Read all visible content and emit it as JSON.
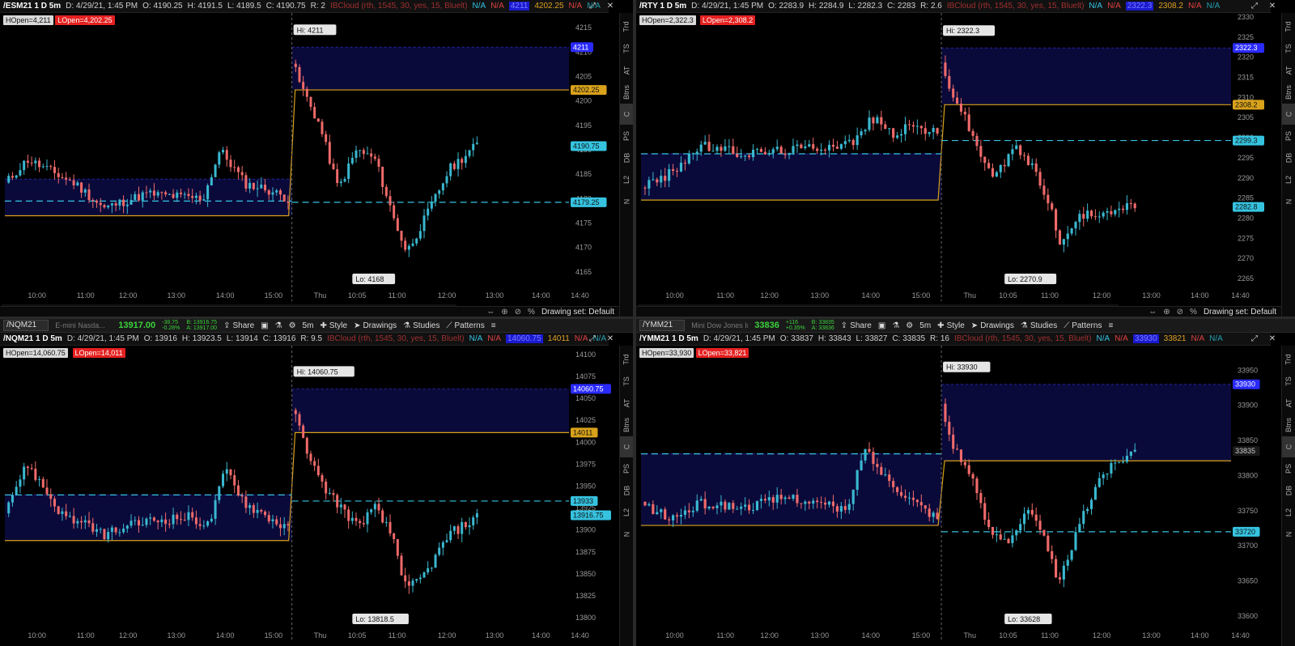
{
  "panes": [
    {
      "id": "esm",
      "toolbar": null,
      "info": {
        "symbol": "/ESM21 1 D 5m",
        "date": "D: 4/29/21, 1:45 PM",
        "open": "O: 4190.25",
        "high": "H: 4191.5",
        "low": "L: 4189.5",
        "close": "C: 4190.75",
        "range": "R: 2",
        "cloud": "IBCloud (rth, 1545, 30, yes, 15, Bluelt)",
        "na1": "N/A",
        "na2": "N/A",
        "val_blue": "4211",
        "val_orange": "4202.25",
        "na3": "N/A",
        "na4": "N/A"
      },
      "hopen": "HOpen=4,211",
      "lopen": "LOpen=4,202.25",
      "hi_label": "Hi: 4211",
      "lo_label": "Lo: 4168",
      "ymin": 4162,
      "ymax": 4218,
      "yticks": [
        "4215",
        "4210",
        "4205",
        "4200",
        "4195",
        "4190",
        "4185",
        "4180",
        "4175",
        "4170",
        "4165"
      ],
      "ytick_vals": [
        4215,
        4210,
        4205,
        4200,
        4195,
        4190,
        4185,
        4180,
        4175,
        4170,
        4165
      ],
      "xticks": [
        "10:00",
        "11:00",
        "12:00",
        "13:00",
        "14:00",
        "15:00",
        "Thu",
        "10:05",
        "11:00",
        "12:00",
        "13:00",
        "14:00",
        "14:40"
      ],
      "tags": [
        {
          "label": "4211",
          "value": 4211,
          "color": "#2a2aff",
          "text": "#fff"
        },
        {
          "label": "4202.25",
          "value": 4202.25,
          "color": "#d9a21b",
          "text": "#111"
        },
        {
          "label": "4190.75",
          "value": 4190.75,
          "color": "#35c3e0",
          "text": "#111"
        },
        {
          "label": "4179.25",
          "value": 4179.25,
          "color": "#35c3e0",
          "text": "#111"
        }
      ],
      "day1": {
        "start": 4183,
        "hi": 4184,
        "lo": 4177,
        "ibhi": 4184,
        "iblo": 4176.5,
        "mid": 4179.25,
        "end": 4178
      },
      "day2": {
        "open": 4206,
        "hi": 4211,
        "lo": 4168,
        "last": 4190.75,
        "ibmid": 4202.25,
        "pivot": 4179.25,
        "gap_top": 4211
      },
      "botbar": {
        "text": "Drawing set: Default"
      }
    },
    {
      "id": "rty",
      "toolbar": null,
      "info": {
        "symbol": "/RTY 1 D 5m",
        "date": "D: 4/29/21, 1:45 PM",
        "open": "O: 2283.9",
        "high": "H: 2284.9",
        "low": "L: 2282.3",
        "close": "C: 2283",
        "range": "R: 2.6",
        "cloud": "IBCloud (rth, 1545, 30, yes, 15, Bluelt)",
        "na1": "N/A",
        "na2": "N/A",
        "val_blue": "2322.3",
        "val_orange": "2308.2",
        "na3": "N/A",
        "na4": "N/A"
      },
      "hopen": "HOpen=2,322.3",
      "lopen": "LOpen=2,308.2",
      "hi_label": "Hi: 2322.3",
      "lo_label": "Lo: 2270.9",
      "ymin": 2263,
      "ymax": 2331,
      "yticks": [
        "2330",
        "2325",
        "2320",
        "2315",
        "2310",
        "2305",
        "2300",
        "2295",
        "2290",
        "2285",
        "2280",
        "2275",
        "2270",
        "2265"
      ],
      "ytick_vals": [
        2330,
        2325,
        2320,
        2315,
        2310,
        2305,
        2300,
        2295,
        2290,
        2285,
        2280,
        2275,
        2270,
        2265
      ],
      "xticks": [
        "10:00",
        "11:00",
        "12:00",
        "13:00",
        "14:00",
        "15:00",
        "Thu",
        "10:05",
        "11:00",
        "12:00",
        "13:00",
        "14:00",
        "14:40"
      ],
      "tags": [
        {
          "label": "2322.3",
          "value": 2322.3,
          "color": "#2a2aff",
          "text": "#fff"
        },
        {
          "label": "2308.2",
          "value": 2308.2,
          "color": "#d9a21b",
          "text": "#111"
        },
        {
          "label": "2299.3",
          "value": 2299.3,
          "color": "#35c3e0",
          "text": "#111"
        },
        {
          "label": "2282.8",
          "value": 2282.8,
          "color": "#35c3e0",
          "text": "#111"
        }
      ],
      "botbar": {
        "text": "Drawing set: Default"
      }
    },
    {
      "id": "nq",
      "toolbar": {
        "symbol": "/NQM21",
        "desc": "E-mini Nasda...",
        "last": "13917.00",
        "chg1": "-38.75",
        "chg2": "-0.28%",
        "bid": "B: 13916.75",
        "ask": "A: 13917.00",
        "share": "Share",
        "drawings": "Drawings",
        "studies": "Studies",
        "patterns": "Patterns",
        "style": "Style",
        "tf": "5m"
      },
      "info": {
        "symbol": "/NQM21 1 D 5m",
        "date": "D: 4/29/21, 1:45 PM",
        "open": "O: 13916",
        "high": "H: 13923.5",
        "low": "L: 13914",
        "close": "C: 13916",
        "range": "R: 9.5",
        "cloud": "IBCloud (rth, 1545, 30, yes, 15, Bluelt)",
        "na1": "N/A",
        "na2": "N/A",
        "val_blue": "14060.75",
        "val_orange": "14011",
        "na3": "N/A",
        "na4": "N/A"
      },
      "hopen": "HOpen=14,060.75",
      "lopen": "LOpen=14,011",
      "hi_label": "Hi: 14060.75",
      "lo_label": "Lo: 13818.5",
      "ymin": 13790,
      "ymax": 14110,
      "yticks": [
        "14100",
        "14075",
        "14050",
        "14025",
        "14000",
        "13975",
        "13950",
        "13925",
        "13900",
        "13875",
        "13850",
        "13825",
        "13800"
      ],
      "ytick_vals": [
        14100,
        14075,
        14050,
        14025,
        14000,
        13975,
        13950,
        13925,
        13900,
        13875,
        13850,
        13825,
        13800
      ],
      "xticks": [
        "10:00",
        "11:00",
        "12:00",
        "13:00",
        "14:00",
        "15:00",
        "Thu",
        "10:05",
        "11:00",
        "12:00",
        "13:00",
        "14:00",
        "14:40"
      ],
      "tags": [
        {
          "label": "14060.75",
          "value": 14060.75,
          "color": "#2a2aff",
          "text": "#fff"
        },
        {
          "label": "14011",
          "value": 14011,
          "color": "#d9a21b",
          "text": "#111"
        },
        {
          "label": "13933",
          "value": 13933,
          "color": "#35c3e0",
          "text": "#111"
        },
        {
          "label": "13916.75",
          "value": 13916.75,
          "color": "#35c3e0",
          "text": "#111"
        }
      ],
      "botbar": null
    },
    {
      "id": "ym",
      "toolbar": {
        "symbol": "/YMM21",
        "desc": "Mini Dow Jones In...",
        "last": "33836",
        "chg1": "+116",
        "chg2": "+0.35%",
        "bid": "B: 33835",
        "ask": "A: 33836",
        "share": "Share",
        "drawings": "Drawings",
        "studies": "Studies",
        "patterns": "Patterns",
        "style": "Style",
        "tf": "5m"
      },
      "info": {
        "symbol": "/YMM21 1 D 5m",
        "date": "D: 4/29/21, 1:45 PM",
        "open": "O: 33837",
        "high": "H: 33843",
        "low": "L: 33827",
        "close": "C: 33835",
        "range": "R: 16",
        "cloud": "IBCloud (rth, 1545, 30, yes, 15, Bluelt)",
        "na1": "N/A",
        "na2": "N/A",
        "val_blue": "33930",
        "val_orange": "33821",
        "na3": "N/A",
        "na4": "N/A"
      },
      "hopen": "HOpen=33,930",
      "lopen": "LOpen=33,821",
      "hi_label": "Hi: 33930",
      "lo_label": "Lo: 33628",
      "ymin": 33585,
      "ymax": 33985,
      "yticks": [
        "33950",
        "33900",
        "33850",
        "33800",
        "33750",
        "33700",
        "33650",
        "33600"
      ],
      "ytick_vals": [
        33950,
        33900,
        33850,
        33800,
        33750,
        33700,
        33650,
        33600
      ],
      "xticks": [
        "10:00",
        "11:00",
        "12:00",
        "13:00",
        "14:00",
        "15:00",
        "Thu",
        "10:05",
        "11:00",
        "12:00",
        "13:00",
        "14:00",
        "14:40"
      ],
      "tags": [
        {
          "label": "33930",
          "value": 33930,
          "color": "#2a2aff",
          "text": "#fff"
        },
        {
          "label": "33835",
          "value": 33835,
          "color": "#1a1a1a",
          "text": "#ccc"
        },
        {
          "label": "33720",
          "value": 33720,
          "color": "#35c3e0",
          "text": "#111"
        }
      ],
      "botbar": null
    }
  ],
  "sidebar_tabs": [
    "Trd",
    "TS",
    "AT",
    "Btns",
    "C",
    "PS",
    "DB",
    "L2",
    "N"
  ],
  "levels": {
    "esm": {
      "cloud1_top": 4184,
      "cloud1_bot": 4176.5,
      "gold1": 4176.5,
      "cyan1": 4179.5,
      "cloud2_top": 4211,
      "cloud2_bot": 4202.25,
      "gold2": 4202.25,
      "cyan2": 4179.25
    },
    "rty": {
      "cloud1_top": 2296,
      "cloud1_bot": 2284.5,
      "gold1": 2284.5,
      "cyan1": 2296,
      "cloud2_top": 2322.3,
      "cloud2_bot": 2308.2,
      "gold2": 2308.2,
      "cyan2": 2299.3
    },
    "nq": {
      "cloud1_top": 13940,
      "cloud1_bot": 13888,
      "gold1": 13888,
      "cyan1": 13940,
      "cloud2_top": 14060.75,
      "cloud2_bot": 14011,
      "gold2": 14011,
      "cyan2": 13933
    },
    "ym": {
      "cloud1_top": 33831,
      "cloud1_bot": 33729,
      "gold1": 33729,
      "cyan1": 33831,
      "cloud2_top": 33930,
      "cloud2_bot": 33821,
      "gold2": 33821,
      "cyan2": 33720
    }
  },
  "colors": {
    "up": "#3ab8d0",
    "down": "#f06a6a",
    "gold": "#d9a21b",
    "cyan": "#35c3e0",
    "cloud": "#0a0a3a",
    "hi_bg": "#e6e6e6"
  }
}
